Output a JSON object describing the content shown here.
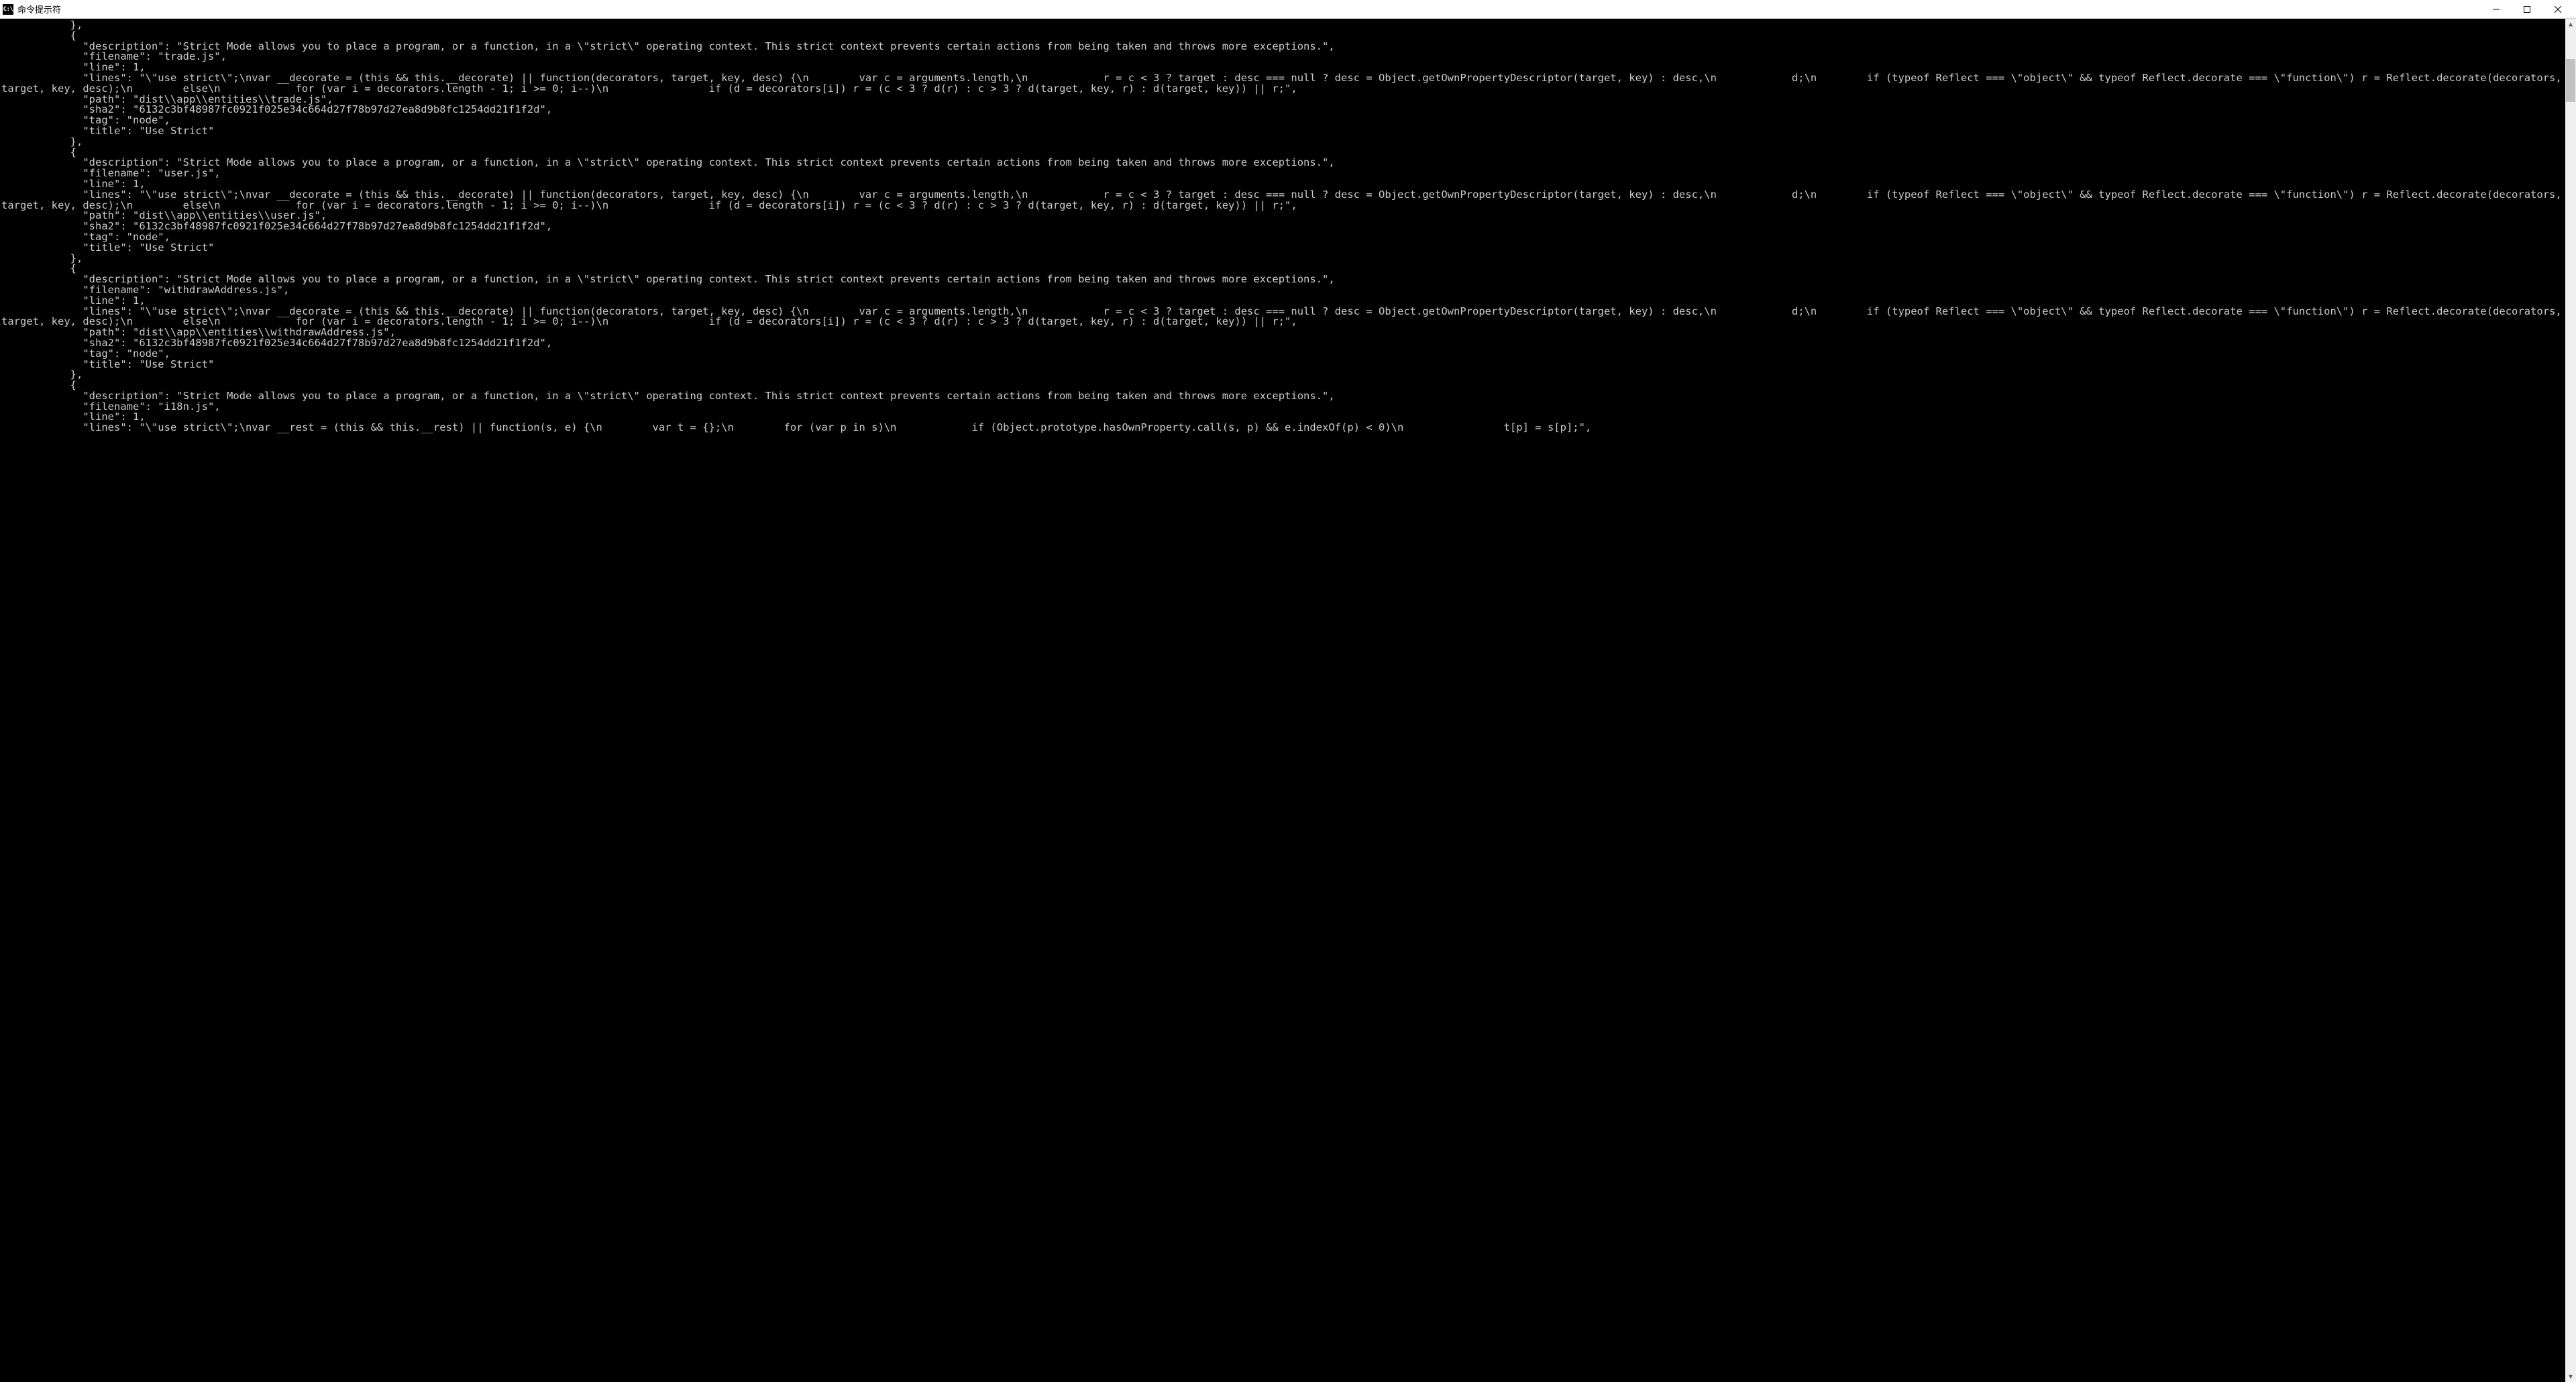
{
  "window": {
    "title": "命令提示符",
    "icon_label": "C:\\"
  },
  "terminal": {
    "lines": [
      "           },",
      "           {",
      "             \"description\": \"Strict Mode allows you to place a program, or a function, in a \\\"strict\\\" operating context. This strict context prevents certain actions from being taken and throws more exceptions.\",",
      "             \"filename\": \"trade.js\",",
      "             \"line\": 1,",
      "             \"lines\": \"\\\"use strict\\\";\\nvar __decorate = (this && this.__decorate) || function(decorators, target, key, desc) {\\n        var c = arguments.length,\\n            r = c < 3 ? target : desc === null ? desc = Object.getOwnPropertyDescriptor(target, key) : desc,\\n            d;\\n        if (typeof Reflect === \\\"object\\\" && typeof Reflect.decorate === \\\"function\\\") r = Reflect.decorate(decorators, target, key, desc);\\n        else\\n            for (var i = decorators.length - 1; i >= 0; i--)\\n                if (d = decorators[i]) r = (c < 3 ? d(r) : c > 3 ? d(target, key, r) : d(target, key)) || r;\",",
      "             \"path\": \"dist\\\\app\\\\entities\\\\trade.js\",",
      "             \"sha2\": \"6132c3bf48987fc0921f025e34c664d27f78b97d27ea8d9b8fc1254dd21f1f2d\",",
      "             \"tag\": \"node\",",
      "             \"title\": \"Use Strict\"",
      "           },",
      "           {",
      "             \"description\": \"Strict Mode allows you to place a program, or a function, in a \\\"strict\\\" operating context. This strict context prevents certain actions from being taken and throws more exceptions.\",",
      "             \"filename\": \"user.js\",",
      "             \"line\": 1,",
      "             \"lines\": \"\\\"use strict\\\";\\nvar __decorate = (this && this.__decorate) || function(decorators, target, key, desc) {\\n        var c = arguments.length,\\n            r = c < 3 ? target : desc === null ? desc = Object.getOwnPropertyDescriptor(target, key) : desc,\\n            d;\\n        if (typeof Reflect === \\\"object\\\" && typeof Reflect.decorate === \\\"function\\\") r = Reflect.decorate(decorators, target, key, desc);\\n        else\\n            for (var i = decorators.length - 1; i >= 0; i--)\\n                if (d = decorators[i]) r = (c < 3 ? d(r) : c > 3 ? d(target, key, r) : d(target, key)) || r;\",",
      "             \"path\": \"dist\\\\app\\\\entities\\\\user.js\",",
      "             \"sha2\": \"6132c3bf48987fc0921f025e34c664d27f78b97d27ea8d9b8fc1254dd21f1f2d\",",
      "             \"tag\": \"node\",",
      "             \"title\": \"Use Strict\"",
      "           },",
      "           {",
      "             \"description\": \"Strict Mode allows you to place a program, or a function, in a \\\"strict\\\" operating context. This strict context prevents certain actions from being taken and throws more exceptions.\",",
      "             \"filename\": \"withdrawAddress.js\",",
      "             \"line\": 1,",
      "             \"lines\": \"\\\"use strict\\\";\\nvar __decorate = (this && this.__decorate) || function(decorators, target, key, desc) {\\n        var c = arguments.length,\\n            r = c < 3 ? target : desc === null ? desc = Object.getOwnPropertyDescriptor(target, key) : desc,\\n            d;\\n        if (typeof Reflect === \\\"object\\\" && typeof Reflect.decorate === \\\"function\\\") r = Reflect.decorate(decorators, target, key, desc);\\n        else\\n            for (var i = decorators.length - 1; i >= 0; i--)\\n                if (d = decorators[i]) r = (c < 3 ? d(r) : c > 3 ? d(target, key, r) : d(target, key)) || r;\",",
      "             \"path\": \"dist\\\\app\\\\entities\\\\withdrawAddress.js\",",
      "             \"sha2\": \"6132c3bf48987fc0921f025e34c664d27f78b97d27ea8d9b8fc1254dd21f1f2d\",",
      "             \"tag\": \"node\",",
      "             \"title\": \"Use Strict\"",
      "           },",
      "           {",
      "             \"description\": \"Strict Mode allows you to place a program, or a function, in a \\\"strict\\\" operating context. This strict context prevents certain actions from being taken and throws more exceptions.\",",
      "             \"filename\": \"i18n.js\",",
      "             \"line\": 1,",
      "             \"lines\": \"\\\"use strict\\\";\\nvar __rest = (this && this.__rest) || function(s, e) {\\n        var t = {};\\n        for (var p in s)\\n            if (Object.prototype.hasOwnProperty.call(s, p) && e.indexOf(p) < 0)\\n                t[p] = s[p];\","
    ]
  }
}
